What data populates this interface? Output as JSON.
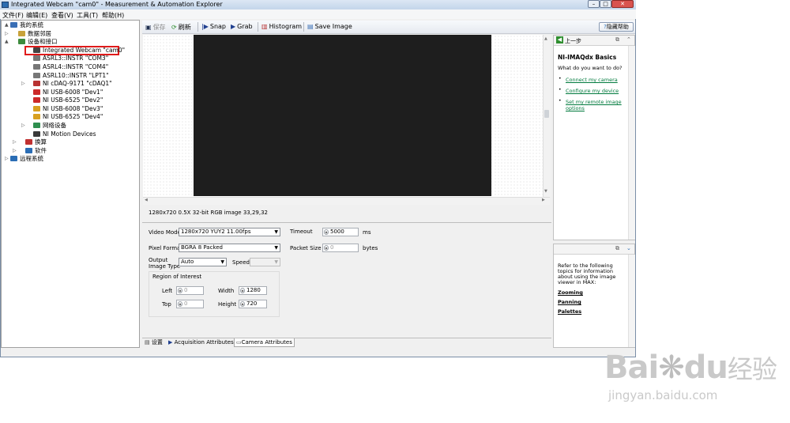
{
  "window": {
    "title": "Integrated Webcam  \"cam0\" - Measurement & Automation Explorer",
    "controls": [
      "–",
      "□",
      "✕"
    ]
  },
  "menu": [
    "文件(F)",
    "编辑(E)",
    "查看(V)",
    "工具(T)",
    "帮助(H)"
  ],
  "tree": [
    {
      "label": "我的系统",
      "icon": "computer-icon",
      "color": "#3a6fb5"
    },
    {
      "label": "数据邻居",
      "icon": "folder-icon",
      "color": "#c8a23a"
    },
    {
      "label": "设备和接口",
      "icon": "devices-icon",
      "color": "#3d8b3d"
    },
    {
      "label": "Integrated Webcam  \"cam0\"",
      "icon": "webcam-icon",
      "color": "#444444"
    },
    {
      "label": "ASRL3::INSTR \"COM3\"",
      "icon": "serial-port-icon",
      "color": "#777777"
    },
    {
      "label": "ASRL4::INSTR \"COM4\"",
      "icon": "serial-port-icon",
      "color": "#777777"
    },
    {
      "label": "ASRL10::INSTR \"LPT1\"",
      "icon": "parallel-port-icon",
      "color": "#777777"
    },
    {
      "label": "NI cDAQ-9171 \"cDAQ1\"",
      "icon": "daq-chassis-icon",
      "color": "#b83232"
    },
    {
      "label": "NI USB-6008 \"Dev1\"",
      "icon": "usb-device-icon",
      "color": "#cc2a2a"
    },
    {
      "label": "NI USB-6525 \"Dev2\"",
      "icon": "usb-device-icon",
      "color": "#cc2a2a"
    },
    {
      "label": "NI USB-6008 \"Dev3\"",
      "icon": "usb-icon",
      "color": "#d8a020"
    },
    {
      "label": "NI USB-6525 \"Dev4\"",
      "icon": "usb-icon",
      "color": "#d8a020"
    },
    {
      "label": "网络设备",
      "icon": "network-icon",
      "color": "#2f8f4f"
    },
    {
      "label": "NI Motion Devices",
      "icon": "motion-icon",
      "color": "#3a3a3a"
    },
    {
      "label": "换算",
      "icon": "scale-icon",
      "color": "#c03030"
    },
    {
      "label": "软件",
      "icon": "software-icon",
      "color": "#2a6db5"
    },
    {
      "label": "远程系统",
      "icon": "remote-systems-icon",
      "color": "#2a6db5"
    }
  ],
  "toolbar": {
    "save": "保存",
    "refresh": "刷新",
    "snap": "Snap",
    "grab": "Grab",
    "histogram": "Histogram",
    "save_image": "Save Image",
    "hide_help": "隐藏帮助"
  },
  "viewer": {
    "status": "1280x720  0.5X  32-bit RGB image  33,29,32"
  },
  "settings": {
    "video_mode_label": "Video Mode",
    "video_mode_value": "1280x720 YUY2 11.00fps",
    "timeout_label": "Timeout",
    "timeout_value": "5000",
    "timeout_unit": "ms",
    "pixel_format_label": "Pixel Format",
    "pixel_format_value": "BGRA 8 Packed",
    "packet_size_label": "Packet Size",
    "packet_size_value": "0",
    "packet_size_unit": "bytes",
    "output_image_type_label_1": "Output",
    "output_image_type_label_2": "Image Type",
    "output_image_type_value": "Auto",
    "speed_label": "Speed",
    "speed_value": "",
    "roi_label": "Region of Interest",
    "left_label": "Left",
    "left_value": "0",
    "width_label": "Width",
    "width_value": "1280",
    "top_label": "Top",
    "top_value": "0",
    "height_label": "Height",
    "height_value": "720"
  },
  "tabs": [
    "设置",
    "Acquisition Attributes",
    "Camera Attributes"
  ],
  "help_top": {
    "back": "上一步",
    "title": "NI-IMAQdx Basics",
    "question": "What do you want to do?",
    "links": [
      "Connect my camera",
      "Configure my device",
      "Set my remote image",
      "options"
    ]
  },
  "help_bottom": {
    "text": [
      "Refer to the following",
      "topics for information",
      "about using the image",
      "viewer in MAX:"
    ],
    "links": [
      "Zooming",
      "Panning",
      "Palettes"
    ]
  },
  "watermark": {
    "brand": "Bai",
    "brand2": "du",
    "cn": "经验",
    "url": "jingyan.baidu.com"
  }
}
